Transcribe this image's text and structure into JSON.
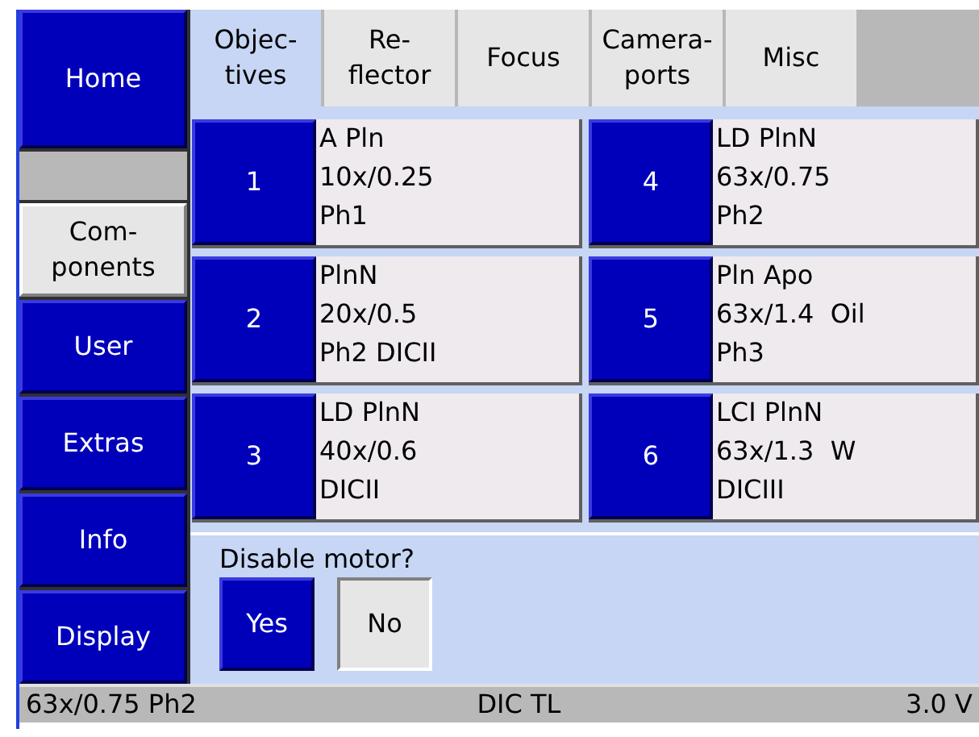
{
  "sidebar": {
    "items": [
      {
        "label": "Home",
        "selected": false
      },
      {
        "kind": "spacer"
      },
      {
        "label": "Com-\nponents",
        "selected": true
      },
      {
        "label": "User",
        "selected": false
      },
      {
        "label": "Extras",
        "selected": false
      },
      {
        "label": "Info",
        "selected": false
      },
      {
        "label": "Display",
        "selected": false
      }
    ]
  },
  "tabs": [
    {
      "label": "Objec-\ntives",
      "selected": true
    },
    {
      "label": "Re-\nflector",
      "selected": false
    },
    {
      "label": "Focus",
      "selected": false
    },
    {
      "label": "Camera-\nports",
      "selected": false
    },
    {
      "label": "Misc",
      "selected": false
    }
  ],
  "objectives": [
    {
      "number": "1",
      "lines": [
        "A Pln",
        "10x/0.25",
        "Ph1"
      ]
    },
    {
      "number": "4",
      "lines": [
        "LD PlnN",
        "63x/0.75",
        "Ph2"
      ]
    },
    {
      "number": "2",
      "lines": [
        "PlnN",
        "20x/0.5",
        "Ph2 DICII"
      ]
    },
    {
      "number": "5",
      "lines": [
        "Pln Apo",
        "63x/1.4  Oil",
        "Ph3"
      ]
    },
    {
      "number": "3",
      "lines": [
        "LD PlnN",
        "40x/0.6",
        "DICII"
      ]
    },
    {
      "number": "6",
      "lines": [
        "LCI PlnN",
        "63x/1.3  W",
        "DICIII"
      ]
    }
  ],
  "disable_motor": {
    "question": "Disable motor?",
    "options": [
      {
        "label": "Yes",
        "selected": true
      },
      {
        "label": "No",
        "selected": false
      }
    ]
  },
  "status_bar": {
    "objective": "63x/0.75 Ph2",
    "reflector": "DIC TL",
    "voltage": "3.0 V"
  }
}
